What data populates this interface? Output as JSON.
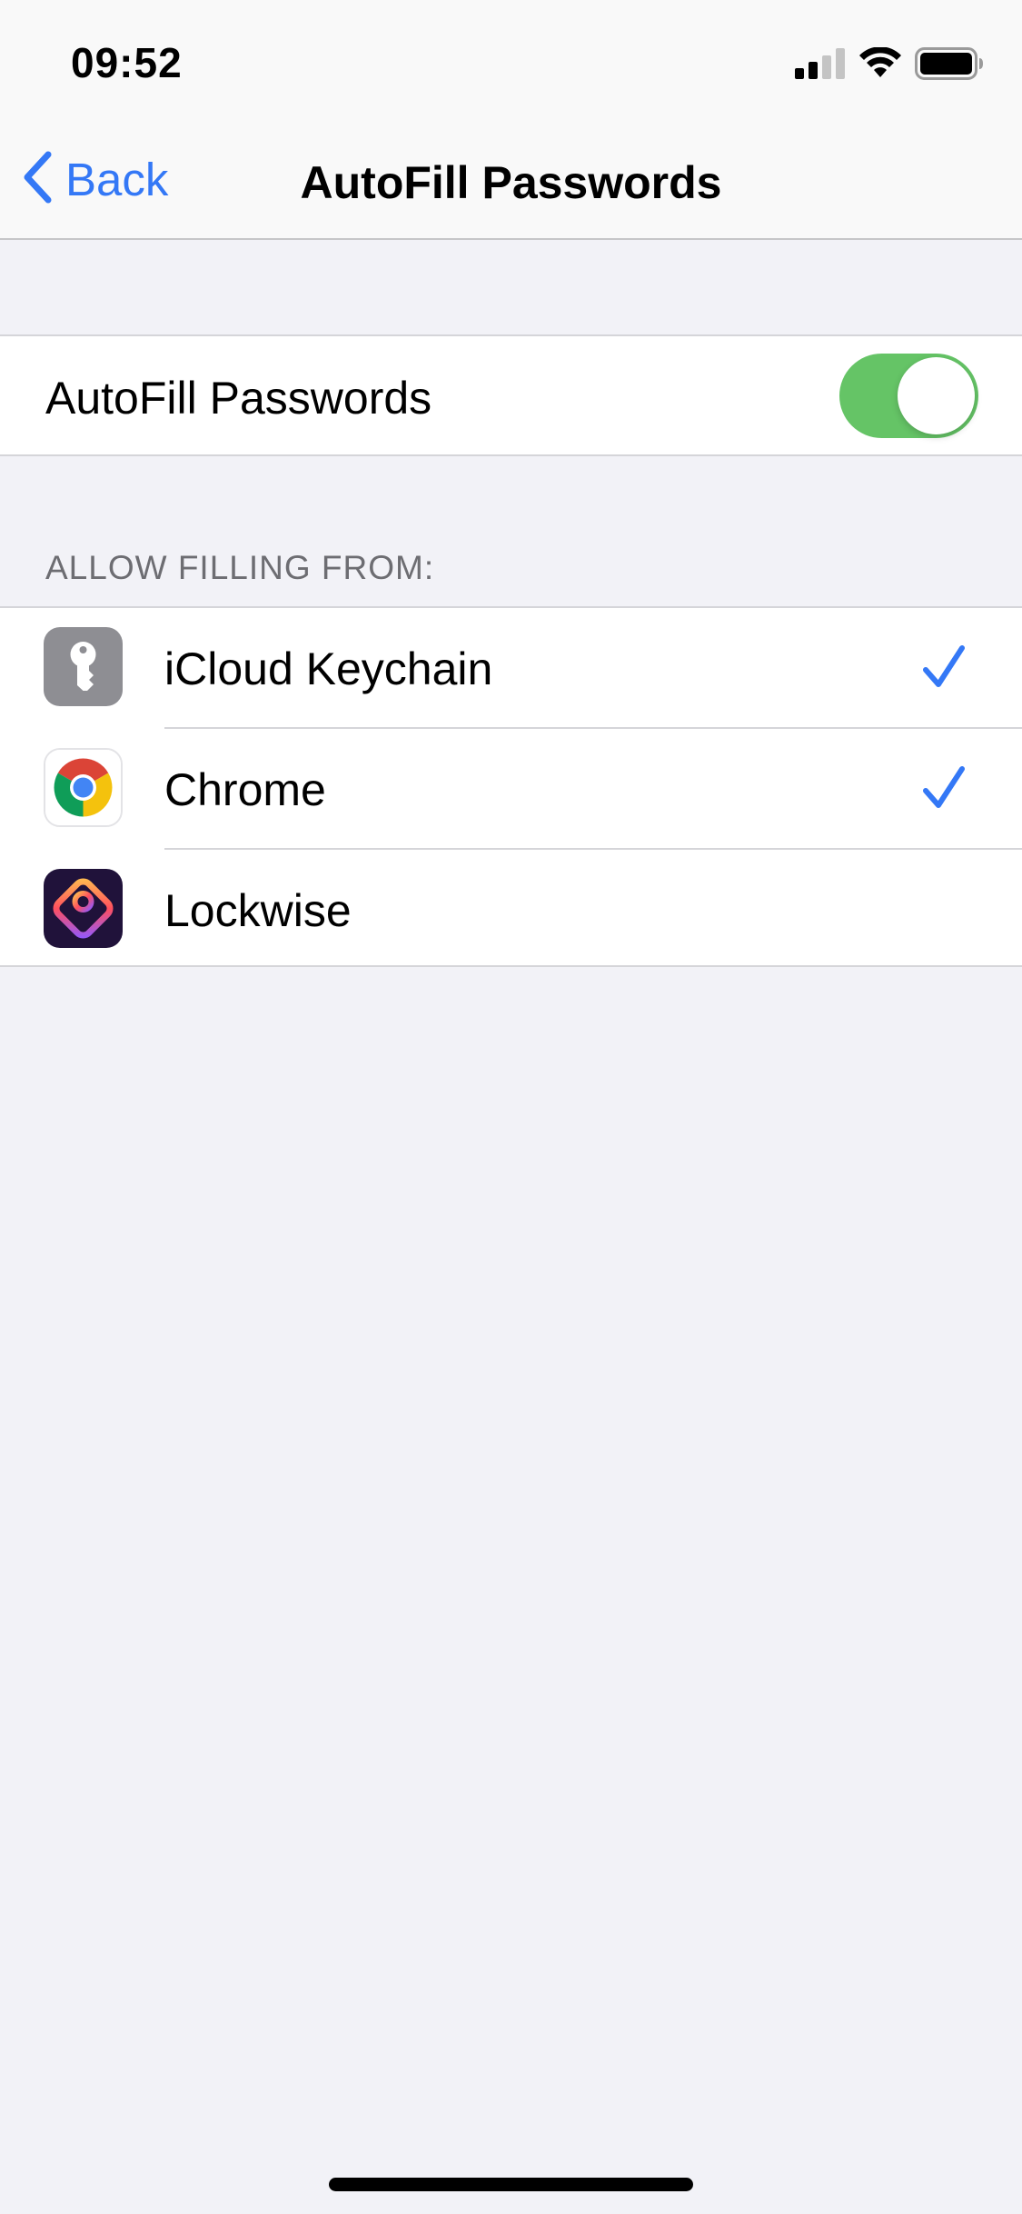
{
  "status_bar": {
    "time": "09:52",
    "icons": [
      "cellular-signal-icon",
      "wifi-icon",
      "battery-icon"
    ]
  },
  "nav": {
    "back_label": "Back",
    "title": "AutoFill Passwords"
  },
  "toggle_row": {
    "label": "AutoFill Passwords",
    "enabled": true
  },
  "section": {
    "header": "ALLOW FILLING FROM:",
    "items": [
      {
        "label": "iCloud Keychain",
        "icon": "keychain-icon",
        "checked": true
      },
      {
        "label": "Chrome",
        "icon": "chrome-icon",
        "checked": true
      },
      {
        "label": "Lockwise",
        "icon": "lockwise-icon",
        "checked": false
      }
    ]
  },
  "colors": {
    "accent": "#3478f6",
    "toggle_on": "#65c466",
    "background": "#f2f2f7",
    "header_text": "#6d6d72"
  }
}
